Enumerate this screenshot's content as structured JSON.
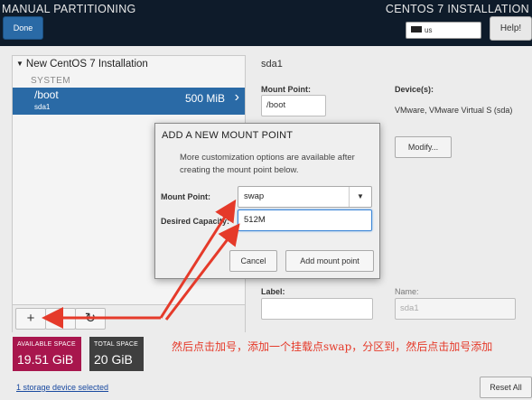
{
  "header": {
    "title": "MANUAL PARTITIONING",
    "install_title": "CENTOS 7 INSTALLATION",
    "done_label": "Done",
    "keyboard_layout": "us",
    "help_label": "Help!"
  },
  "left_panel": {
    "tree_title": "New CentOS 7 Installation",
    "section_label": "SYSTEM",
    "partitions": [
      {
        "name": "/boot",
        "device": "sda1",
        "size": "500 MiB"
      }
    ],
    "add_label": "+",
    "refresh_label": "↻"
  },
  "space": {
    "available_label": "AVAILABLE SPACE",
    "available_value": "19.51 GiB",
    "total_label": "TOTAL SPACE",
    "total_value": "20 GiB"
  },
  "footer": {
    "storage_link": "1 storage device selected",
    "reset_label": "Reset All"
  },
  "detail": {
    "title": "sda1",
    "mount_point_label": "Mount Point:",
    "mount_point_value": "/boot",
    "devices_label": "Device(s):",
    "devices_value": "VMware, VMware Virtual S (sda)",
    "modify_label": "Modify...",
    "label_label": "Label:",
    "label_value": "",
    "name_label": "Name:",
    "name_value": "sda1"
  },
  "dialog": {
    "title": "ADD A NEW MOUNT POINT",
    "description": "More customization options are available after creating the mount point below.",
    "mount_point_label": "Mount Point:",
    "mount_point_value": "swap",
    "capacity_label": "Desired Capacity:",
    "capacity_value": "512M",
    "cancel_label": "Cancel",
    "add_label": "Add mount point"
  },
  "annotation": {
    "text": "然后点击加号，添加一个挂载点swap，分区到，然后点击加号添加",
    "color": "#e53a2a"
  },
  "colors": {
    "header_bg": "#0e1b2a",
    "accent": "#2a6aa6",
    "available_bg": "#a8164d",
    "total_bg": "#3f3f3f"
  }
}
